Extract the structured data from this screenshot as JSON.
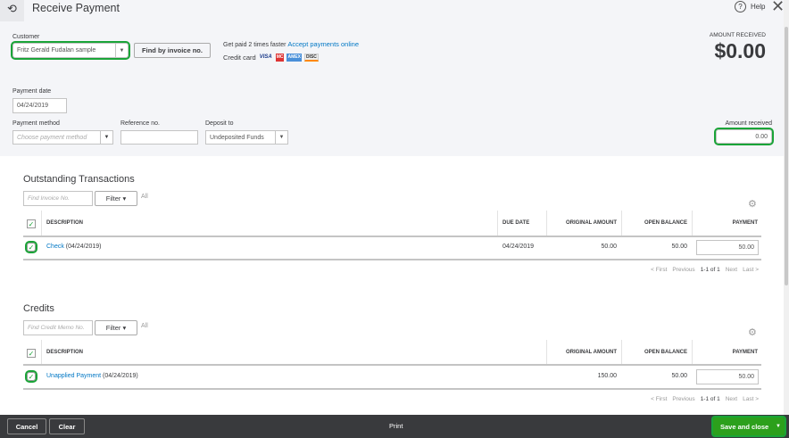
{
  "header": {
    "title": "Receive Payment",
    "help": "Help"
  },
  "customer": {
    "label": "Customer",
    "value": "Fritz Gerald Fudalan sample",
    "find_button": "Find by invoice no."
  },
  "promo": {
    "text": "Get paid 2 times faster",
    "link": "Accept payments online",
    "credit_card": "Credit card",
    "cards": [
      "VISA",
      "MC",
      "AMEX",
      "DISC"
    ]
  },
  "amount_received_summary": {
    "label": "AMOUNT RECEIVED",
    "value": "$0.00"
  },
  "payment_date": {
    "label": "Payment date",
    "value": "04/24/2019"
  },
  "payment_method": {
    "label": "Payment method",
    "placeholder": "Choose payment method"
  },
  "reference": {
    "label": "Reference no.",
    "value": ""
  },
  "deposit_to": {
    "label": "Deposit to",
    "value": "Undeposited Funds"
  },
  "amount_received": {
    "label": "Amount received",
    "value": "0.00"
  },
  "outstanding": {
    "title": "Outstanding Transactions",
    "search_placeholder": "Find Invoice No.",
    "filter": "Filter",
    "all": "All",
    "columns": [
      "DESCRIPTION",
      "DUE DATE",
      "ORIGINAL AMOUNT",
      "OPEN BALANCE",
      "PAYMENT"
    ],
    "rows": [
      {
        "link": "Check",
        "desc": "(04/24/2019)",
        "due": "04/24/2019",
        "original": "50.00",
        "open": "50.00",
        "payment": "50.00"
      }
    ],
    "pager": {
      "first": "< First",
      "previous": "Previous",
      "range": "1-1 of 1",
      "next": "Next",
      "last": "Last >"
    }
  },
  "credits": {
    "title": "Credits",
    "search_placeholder": "Find Credit Memo No.",
    "filter": "Filter",
    "all": "All",
    "columns": [
      "DESCRIPTION",
      "ORIGINAL AMOUNT",
      "OPEN BALANCE",
      "PAYMENT"
    ],
    "rows": [
      {
        "link": "Unapplied Payment",
        "desc": "(04/24/2019)",
        "original": "150.00",
        "open": "50.00",
        "payment": "50.00"
      }
    ],
    "pager": {
      "first": "< First",
      "previous": "Previous",
      "range": "1-1 of 1",
      "next": "Next",
      "last": "Last >"
    }
  },
  "footer": {
    "cancel": "Cancel",
    "clear": "Clear",
    "print": "Print",
    "save": "Save and close"
  }
}
